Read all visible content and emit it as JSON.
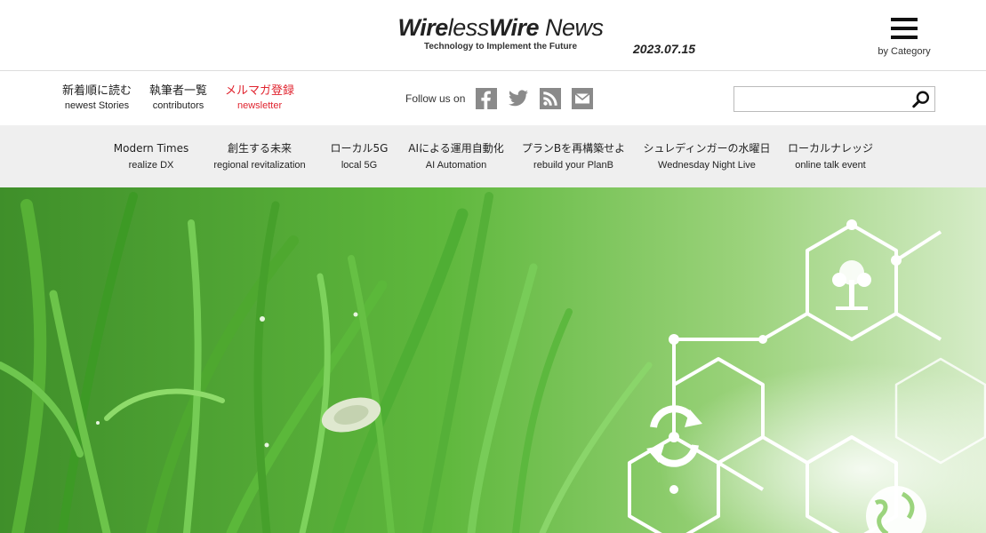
{
  "header": {
    "logo_parts": [
      "Wire",
      "less",
      "Wire",
      " News"
    ],
    "tagline": "Technology to Implement the Future",
    "date": "2023.07.15",
    "menu_label": "by Category"
  },
  "quicklinks": [
    {
      "jp": "新着順に読む",
      "en": "newest Stories"
    },
    {
      "jp": "執筆者一覧",
      "en": "contributors"
    },
    {
      "jp": "メルマガ登録",
      "en": "newsletter"
    }
  ],
  "follow": {
    "label": "Follow us on",
    "icons": [
      "facebook-icon",
      "twitter-icon",
      "rss-icon",
      "mail-icon"
    ]
  },
  "search": {
    "placeholder": ""
  },
  "categories": [
    {
      "jp": "Modern Times",
      "en": "realize DX"
    },
    {
      "jp": "創生する未来",
      "en": "regional revitalization"
    },
    {
      "jp": "ローカル5G",
      "en": "local 5G"
    },
    {
      "jp": "AIによる運用自動化",
      "en": "AI Automation"
    },
    {
      "jp": "プランBを再構築せよ",
      "en": "rebuild your PlanB"
    },
    {
      "jp": "シュレディンガーの水曜日",
      "en": "Wednesday Night Live"
    },
    {
      "jp": "ローカルナレッジ",
      "en": "online talk event"
    }
  ],
  "colors": {
    "accent_red": "#e0242f",
    "social_gray": "#8a8a8a",
    "nav_bg": "#efefef",
    "grass_green": "#4fae34"
  },
  "hero": {
    "icons": [
      "tree-icon",
      "recycle-icon",
      "globe-icon"
    ]
  }
}
